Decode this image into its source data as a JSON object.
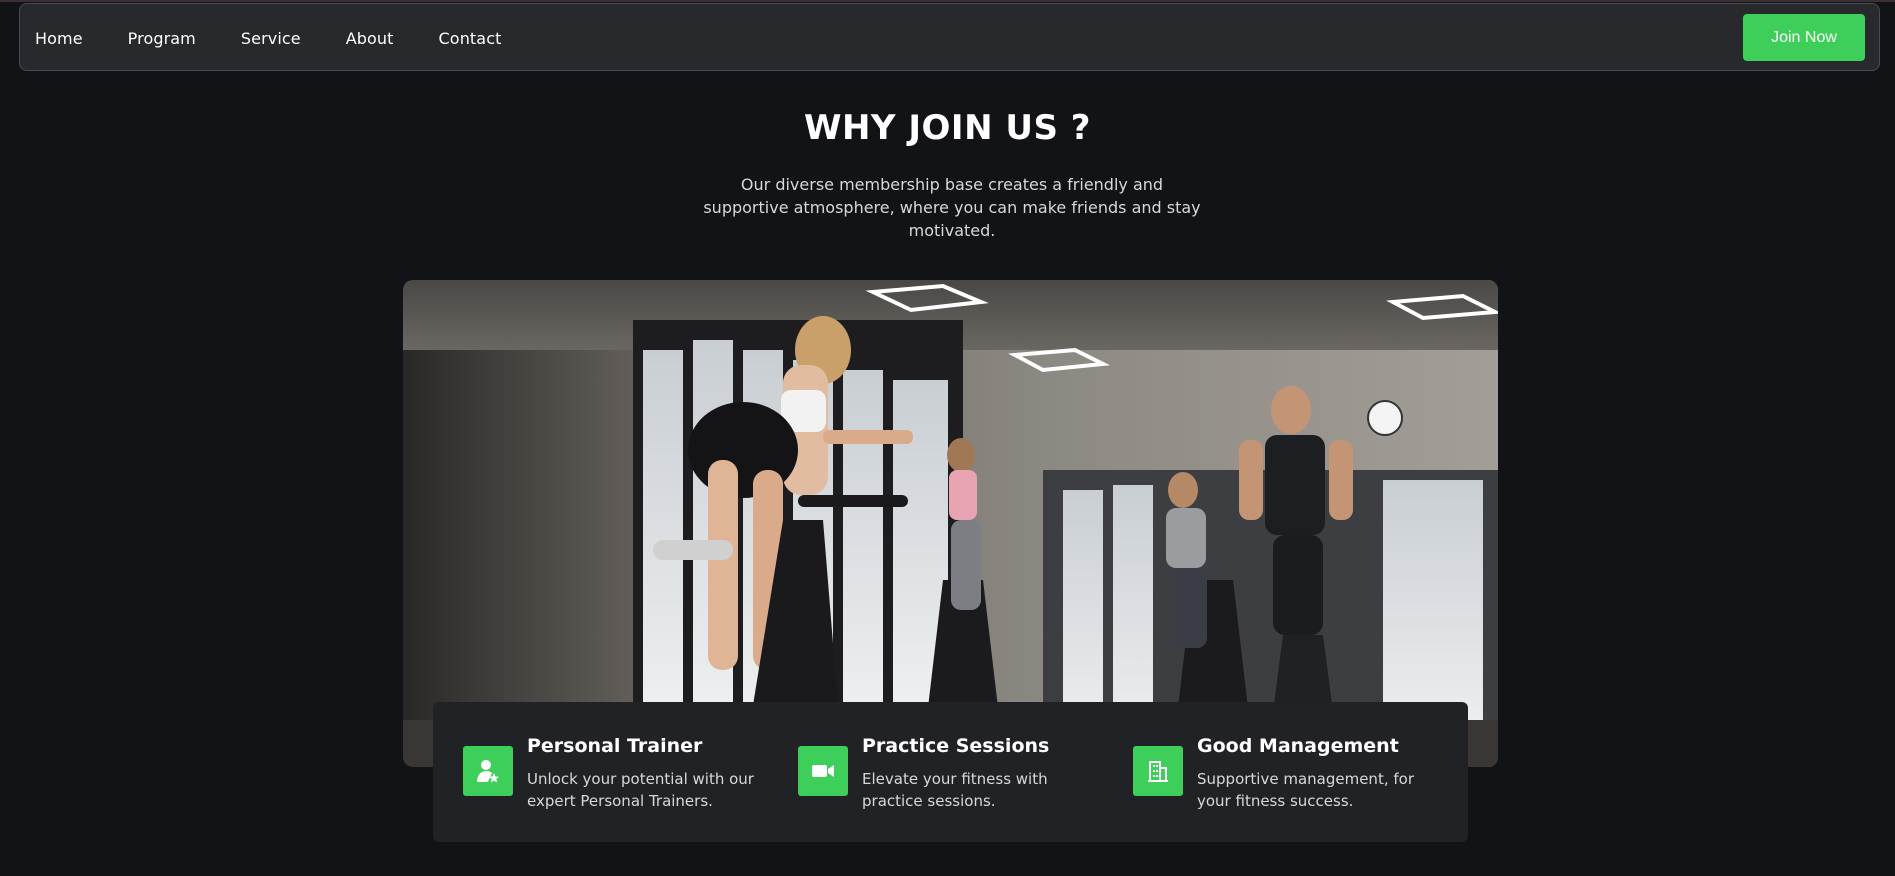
{
  "nav": {
    "links": [
      "Home",
      "Program",
      "Service",
      "About",
      "Contact"
    ],
    "cta_label": "Join Now"
  },
  "section": {
    "title": "WHY JOIN US ?",
    "description": "Our diverse membership base creates a friendly and supportive atmosphere, where you can make friends and stay motivated."
  },
  "hero_image": {
    "subject": "indoor cycling class in gym"
  },
  "features": [
    {
      "title": "Personal Trainer",
      "description": "Unlock your potential with our expert Personal Trainers.",
      "icon": "trainer-badge-icon"
    },
    {
      "title": "Practice Sessions",
      "description": "Elevate your fitness with practice sessions.",
      "icon": "video-camera-icon"
    },
    {
      "title": "Good Management",
      "description": "Supportive management, for your fitness success.",
      "icon": "building-icon"
    }
  ],
  "colors": {
    "background": "#121317",
    "nav_background": "#28292d",
    "accent": "#3ecf5a",
    "card_background": "#212226"
  }
}
